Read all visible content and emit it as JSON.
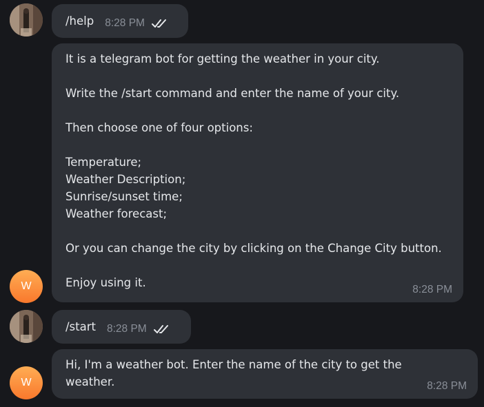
{
  "messages": [
    {
      "sender": "user",
      "text": "/help",
      "time": "8:28 PM",
      "status": "read-double-check-icon"
    },
    {
      "sender": "bot",
      "avatar_letter": "W",
      "text": "It is a telegram bot for getting the weather in your city.\n\nWrite the /start command and enter the name of your city.\n\nThen choose one of four options:\n\nTemperature;\nWeather Description;\nSunrise/sunset time;\nWeather forecast;\n\nOr you can change the city by clicking on the Change City button.\n\nEnjoy using it.",
      "time": "8:28 PM"
    },
    {
      "sender": "user",
      "text": "/start",
      "time": "8:28 PM",
      "status": "read-double-check-icon"
    },
    {
      "sender": "bot",
      "avatar_letter": "W",
      "text": "Hi, I'm a weather bot. Enter the name of the city to get the\nweather.",
      "time": "8:28 PM"
    }
  ],
  "colors": {
    "background": "#17181c",
    "bubble": "#2e3137",
    "text": "#e6e8eb",
    "timestamp": "#8a8f98",
    "bot_avatar": "#f98a35"
  }
}
